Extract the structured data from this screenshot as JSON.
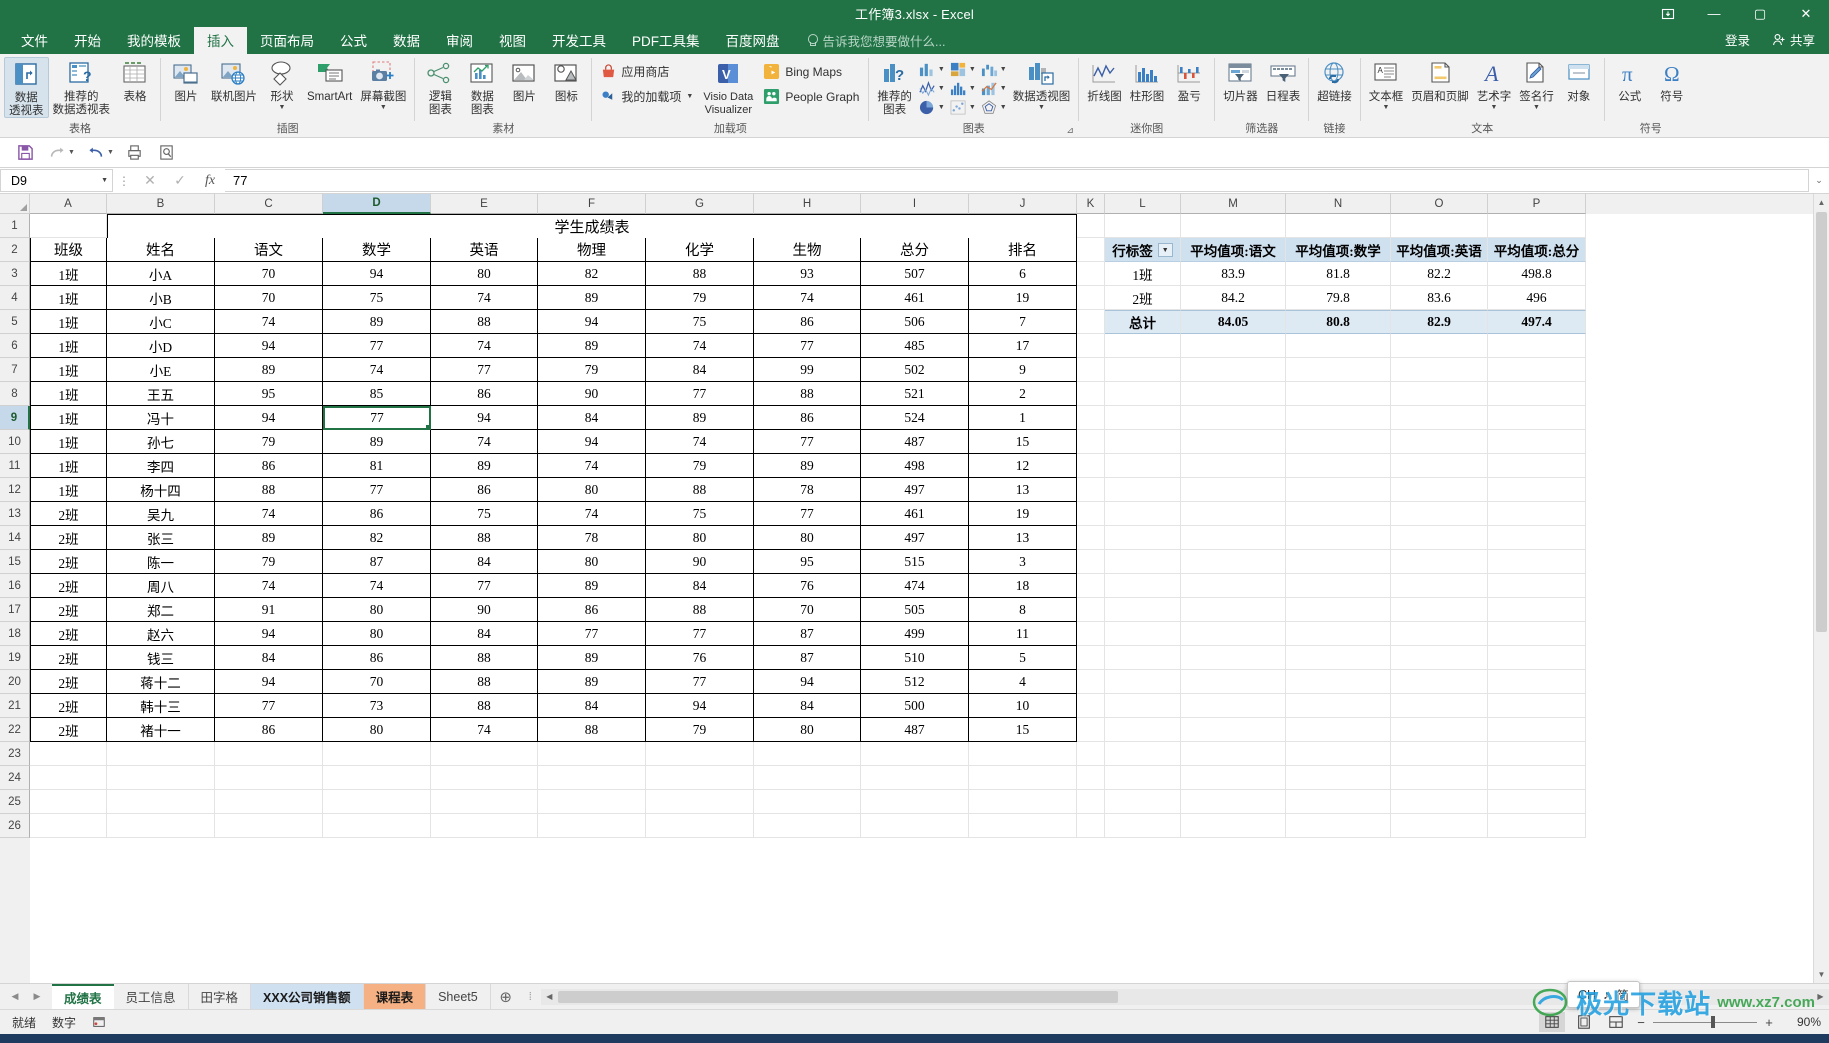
{
  "titlebar": {
    "title": "工作簿3.xlsx - Excel",
    "ribbon_display_icon": "ribbon-display-options-icon",
    "minimize": "—",
    "maximize": "▢",
    "close": "✕"
  },
  "tabs": [
    {
      "label": "文件",
      "active": false
    },
    {
      "label": "开始",
      "active": false
    },
    {
      "label": "我的模板",
      "active": false
    },
    {
      "label": "插入",
      "active": true
    },
    {
      "label": "页面布局",
      "active": false
    },
    {
      "label": "公式",
      "active": false
    },
    {
      "label": "数据",
      "active": false
    },
    {
      "label": "审阅",
      "active": false
    },
    {
      "label": "视图",
      "active": false
    },
    {
      "label": "开发工具",
      "active": false
    },
    {
      "label": "PDF工具集",
      "active": false
    },
    {
      "label": "百度网盘",
      "active": false
    }
  ],
  "tell_me": "告诉我您想要做什么...",
  "account": {
    "signin": "登录",
    "share": "共享"
  },
  "ribbon": {
    "groups": [
      {
        "title": "表格",
        "items": [
          {
            "label": "数据\n透视表",
            "icon": "pivot-table-icon",
            "selected": true
          },
          {
            "label": "推荐的\n数据透视表",
            "icon": "recommended-pivot-table-icon"
          },
          {
            "label": "表格",
            "icon": "table-icon"
          }
        ]
      },
      {
        "title": "插图",
        "items": [
          {
            "label": "图片",
            "icon": "picture-icon"
          },
          {
            "label": "联机图片",
            "icon": "online-picture-icon"
          },
          {
            "label": "形状",
            "icon": "shapes-icon",
            "dropdown": true
          },
          {
            "label": "SmartArt",
            "icon": "smartart-icon"
          },
          {
            "label": "屏幕截图",
            "icon": "screenshot-icon",
            "dropdown": true
          }
        ]
      },
      {
        "title": "素材",
        "items": [
          {
            "label": "逻辑\n图表",
            "icon": "logic-chart-icon"
          },
          {
            "label": "数据\n图表",
            "icon": "data-chart-icon"
          },
          {
            "label": "图片",
            "icon": "material-picture-icon"
          },
          {
            "label": "图标",
            "icon": "material-icon-icon"
          }
        ]
      },
      {
        "title": "加载项",
        "small_items": [
          {
            "label": "应用商店",
            "icon": "app-store-icon"
          },
          {
            "label": "我的加载项",
            "icon": "my-addins-icon",
            "dropdown": true
          }
        ],
        "items": [
          {
            "label": "Visio Data\nVisualizer",
            "icon": "visio-data-visualizer-icon"
          }
        ],
        "stacked_items": [
          {
            "label": "Bing Maps",
            "icon": "bing-maps-icon"
          },
          {
            "label": "People Graph",
            "icon": "people-graph-icon"
          }
        ]
      },
      {
        "title": "图表",
        "items": [
          {
            "label": "推荐的\n图表",
            "icon": "recommended-charts-icon"
          },
          {
            "label": "数据透视图",
            "icon": "pivot-chart-icon",
            "dropdown": true
          }
        ],
        "mini_items": [
          {
            "icon": "column-chart-icon"
          },
          {
            "icon": "hierarchy-chart-icon"
          },
          {
            "icon": "waterfall-chart-icon"
          },
          {
            "icon": "line-chart-icon"
          },
          {
            "icon": "statistic-chart-icon"
          },
          {
            "icon": "combo-chart-icon"
          },
          {
            "icon": "pie-chart-icon"
          },
          {
            "icon": "scatter-chart-icon"
          },
          {
            "icon": "radar-chart-icon"
          }
        ],
        "dialog_launcher": "chart-dialog-launcher"
      },
      {
        "title": "迷你图",
        "items": [
          {
            "label": "折线图",
            "icon": "sparkline-line-icon"
          },
          {
            "label": "柱形图",
            "icon": "sparkline-column-icon"
          },
          {
            "label": "盈亏",
            "icon": "sparkline-winloss-icon"
          }
        ]
      },
      {
        "title": "筛选器",
        "items": [
          {
            "label": "切片器",
            "icon": "slicer-icon"
          },
          {
            "label": "日程表",
            "icon": "timeline-icon"
          }
        ]
      },
      {
        "title": "链接",
        "items": [
          {
            "label": "超链接",
            "icon": "hyperlink-icon"
          }
        ]
      },
      {
        "title": "文本",
        "items": [
          {
            "label": "文本框",
            "icon": "text-box-icon",
            "dropdown": true
          },
          {
            "label": "页眉和页脚",
            "icon": "header-footer-icon"
          },
          {
            "label": "艺术字",
            "icon": "wordart-icon",
            "dropdown": true
          },
          {
            "label": "签名行",
            "icon": "signature-line-icon",
            "dropdown": true
          },
          {
            "label": "对象",
            "icon": "object-icon"
          }
        ]
      },
      {
        "title": "符号",
        "items": [
          {
            "label": "公式",
            "icon": "equation-icon"
          },
          {
            "label": "符号",
            "icon": "symbol-icon"
          }
        ]
      }
    ]
  },
  "qat": [
    {
      "name": "save-button",
      "icon": "save-icon"
    },
    {
      "name": "redo-button",
      "icon": "redo-icon",
      "dropdown": true
    },
    {
      "name": "undo-button",
      "icon": "undo-icon",
      "dropdown": true
    },
    {
      "name": "quick-print-button",
      "icon": "quick-print-icon"
    },
    {
      "name": "print-preview-button",
      "icon": "print-preview-icon"
    }
  ],
  "formula_bar": {
    "name_box": "D9",
    "cancel": "✕",
    "enter": "✓",
    "insert_function": "fx",
    "value": "77",
    "expand": "⌄"
  },
  "grid": {
    "columns": [
      "A",
      "B",
      "C",
      "D",
      "E",
      "F",
      "G",
      "H",
      "I",
      "J",
      "K",
      "L",
      "M",
      "N",
      "O",
      "P"
    ],
    "selected_column": "D",
    "selected_row": "9",
    "active_cell": "D9",
    "rows": [
      "1",
      "2",
      "3",
      "4",
      "5",
      "6",
      "7",
      "8",
      "9",
      "10",
      "11",
      "12",
      "13",
      "14",
      "15",
      "16",
      "17",
      "18",
      "19",
      "20",
      "21",
      "22",
      "23",
      "24",
      "25",
      "26"
    ],
    "sheet_title": "学生成绩表",
    "table_headers": [
      "班级",
      "姓名",
      "语文",
      "数学",
      "英语",
      "物理",
      "化学",
      "生物",
      "总分",
      "排名"
    ],
    "table_rows": [
      [
        "1班",
        "小A",
        "70",
        "94",
        "80",
        "82",
        "88",
        "93",
        "507",
        "6"
      ],
      [
        "1班",
        "小B",
        "70",
        "75",
        "74",
        "89",
        "79",
        "74",
        "461",
        "19"
      ],
      [
        "1班",
        "小C",
        "74",
        "89",
        "88",
        "94",
        "75",
        "86",
        "506",
        "7"
      ],
      [
        "1班",
        "小D",
        "94",
        "77",
        "74",
        "89",
        "74",
        "77",
        "485",
        "17"
      ],
      [
        "1班",
        "小E",
        "89",
        "74",
        "77",
        "79",
        "84",
        "99",
        "502",
        "9"
      ],
      [
        "1班",
        "王五",
        "95",
        "85",
        "86",
        "90",
        "77",
        "88",
        "521",
        "2"
      ],
      [
        "1班",
        "冯十",
        "94",
        "77",
        "94",
        "84",
        "89",
        "86",
        "524",
        "1"
      ],
      [
        "1班",
        "孙七",
        "79",
        "89",
        "74",
        "94",
        "74",
        "77",
        "487",
        "15"
      ],
      [
        "1班",
        "李四",
        "86",
        "81",
        "89",
        "74",
        "79",
        "89",
        "498",
        "12"
      ],
      [
        "1班",
        "杨十四",
        "88",
        "77",
        "86",
        "80",
        "88",
        "78",
        "497",
        "13"
      ],
      [
        "2班",
        "吴九",
        "74",
        "86",
        "75",
        "74",
        "75",
        "77",
        "461",
        "19"
      ],
      [
        "2班",
        "张三",
        "89",
        "82",
        "88",
        "78",
        "80",
        "80",
        "497",
        "13"
      ],
      [
        "2班",
        "陈一",
        "79",
        "87",
        "84",
        "80",
        "90",
        "95",
        "515",
        "3"
      ],
      [
        "2班",
        "周八",
        "74",
        "74",
        "77",
        "89",
        "84",
        "76",
        "474",
        "18"
      ],
      [
        "2班",
        "郑二",
        "91",
        "80",
        "90",
        "86",
        "88",
        "70",
        "505",
        "8"
      ],
      [
        "2班",
        "赵六",
        "94",
        "80",
        "84",
        "77",
        "77",
        "87",
        "499",
        "11"
      ],
      [
        "2班",
        "钱三",
        "84",
        "86",
        "88",
        "89",
        "76",
        "87",
        "510",
        "5"
      ],
      [
        "2班",
        "蒋十二",
        "94",
        "70",
        "88",
        "89",
        "77",
        "94",
        "512",
        "4"
      ],
      [
        "2班",
        "韩十三",
        "77",
        "73",
        "88",
        "84",
        "94",
        "84",
        "500",
        "10"
      ],
      [
        "2班",
        "褚十一",
        "86",
        "80",
        "74",
        "88",
        "79",
        "80",
        "487",
        "15"
      ]
    ]
  },
  "pivot_table": {
    "headers": [
      "行标签",
      "平均值项:语文",
      "平均值项:数学",
      "平均值项:英语",
      "平均值项:总分"
    ],
    "filter_icon": "filter-dropdown-icon",
    "rows": [
      [
        "1班",
        "83.9",
        "81.8",
        "82.2",
        "498.8"
      ],
      [
        "2班",
        "84.2",
        "79.8",
        "83.6",
        "496"
      ]
    ],
    "total_row": [
      "总计",
      "84.05",
      "80.8",
      "82.9",
      "497.4"
    ]
  },
  "sheet_tabs": [
    {
      "label": "成绩表",
      "state": "active"
    },
    {
      "label": "员工信息",
      "state": "normal"
    },
    {
      "label": "田字格",
      "state": "normal"
    },
    {
      "label": "XXX公司销售额",
      "state": "blue"
    },
    {
      "label": "课程表",
      "state": "orange"
    },
    {
      "label": "Sheet5",
      "state": "normal"
    }
  ],
  "add_sheet": "⊕",
  "status_bar": {
    "mode": "就绪",
    "number_mode": "数字",
    "macro_icon": "record-macro-icon",
    "views": [
      {
        "name": "normal-view-button",
        "icon": "grid-view-icon",
        "active": true
      },
      {
        "name": "page-layout-view-button",
        "icon": "page-layout-icon",
        "active": false
      },
      {
        "name": "page-break-view-button",
        "icon": "page-break-icon",
        "active": false
      }
    ],
    "zoom_out": "−",
    "zoom_in": "+",
    "zoom_level": "90%"
  },
  "ime_popup": {
    "lang": "CH",
    "tone": "♪",
    "mode": "简"
  },
  "watermark": {
    "text": "极光下载站",
    "url": "www.xz7.com"
  },
  "colors": {
    "excel_green": "#217346",
    "ribbon_bg": "#f2f2f2",
    "pivot_header": "#cfe0ef",
    "pivot_total": "#ddeaf4",
    "selection_green": "#217346"
  }
}
